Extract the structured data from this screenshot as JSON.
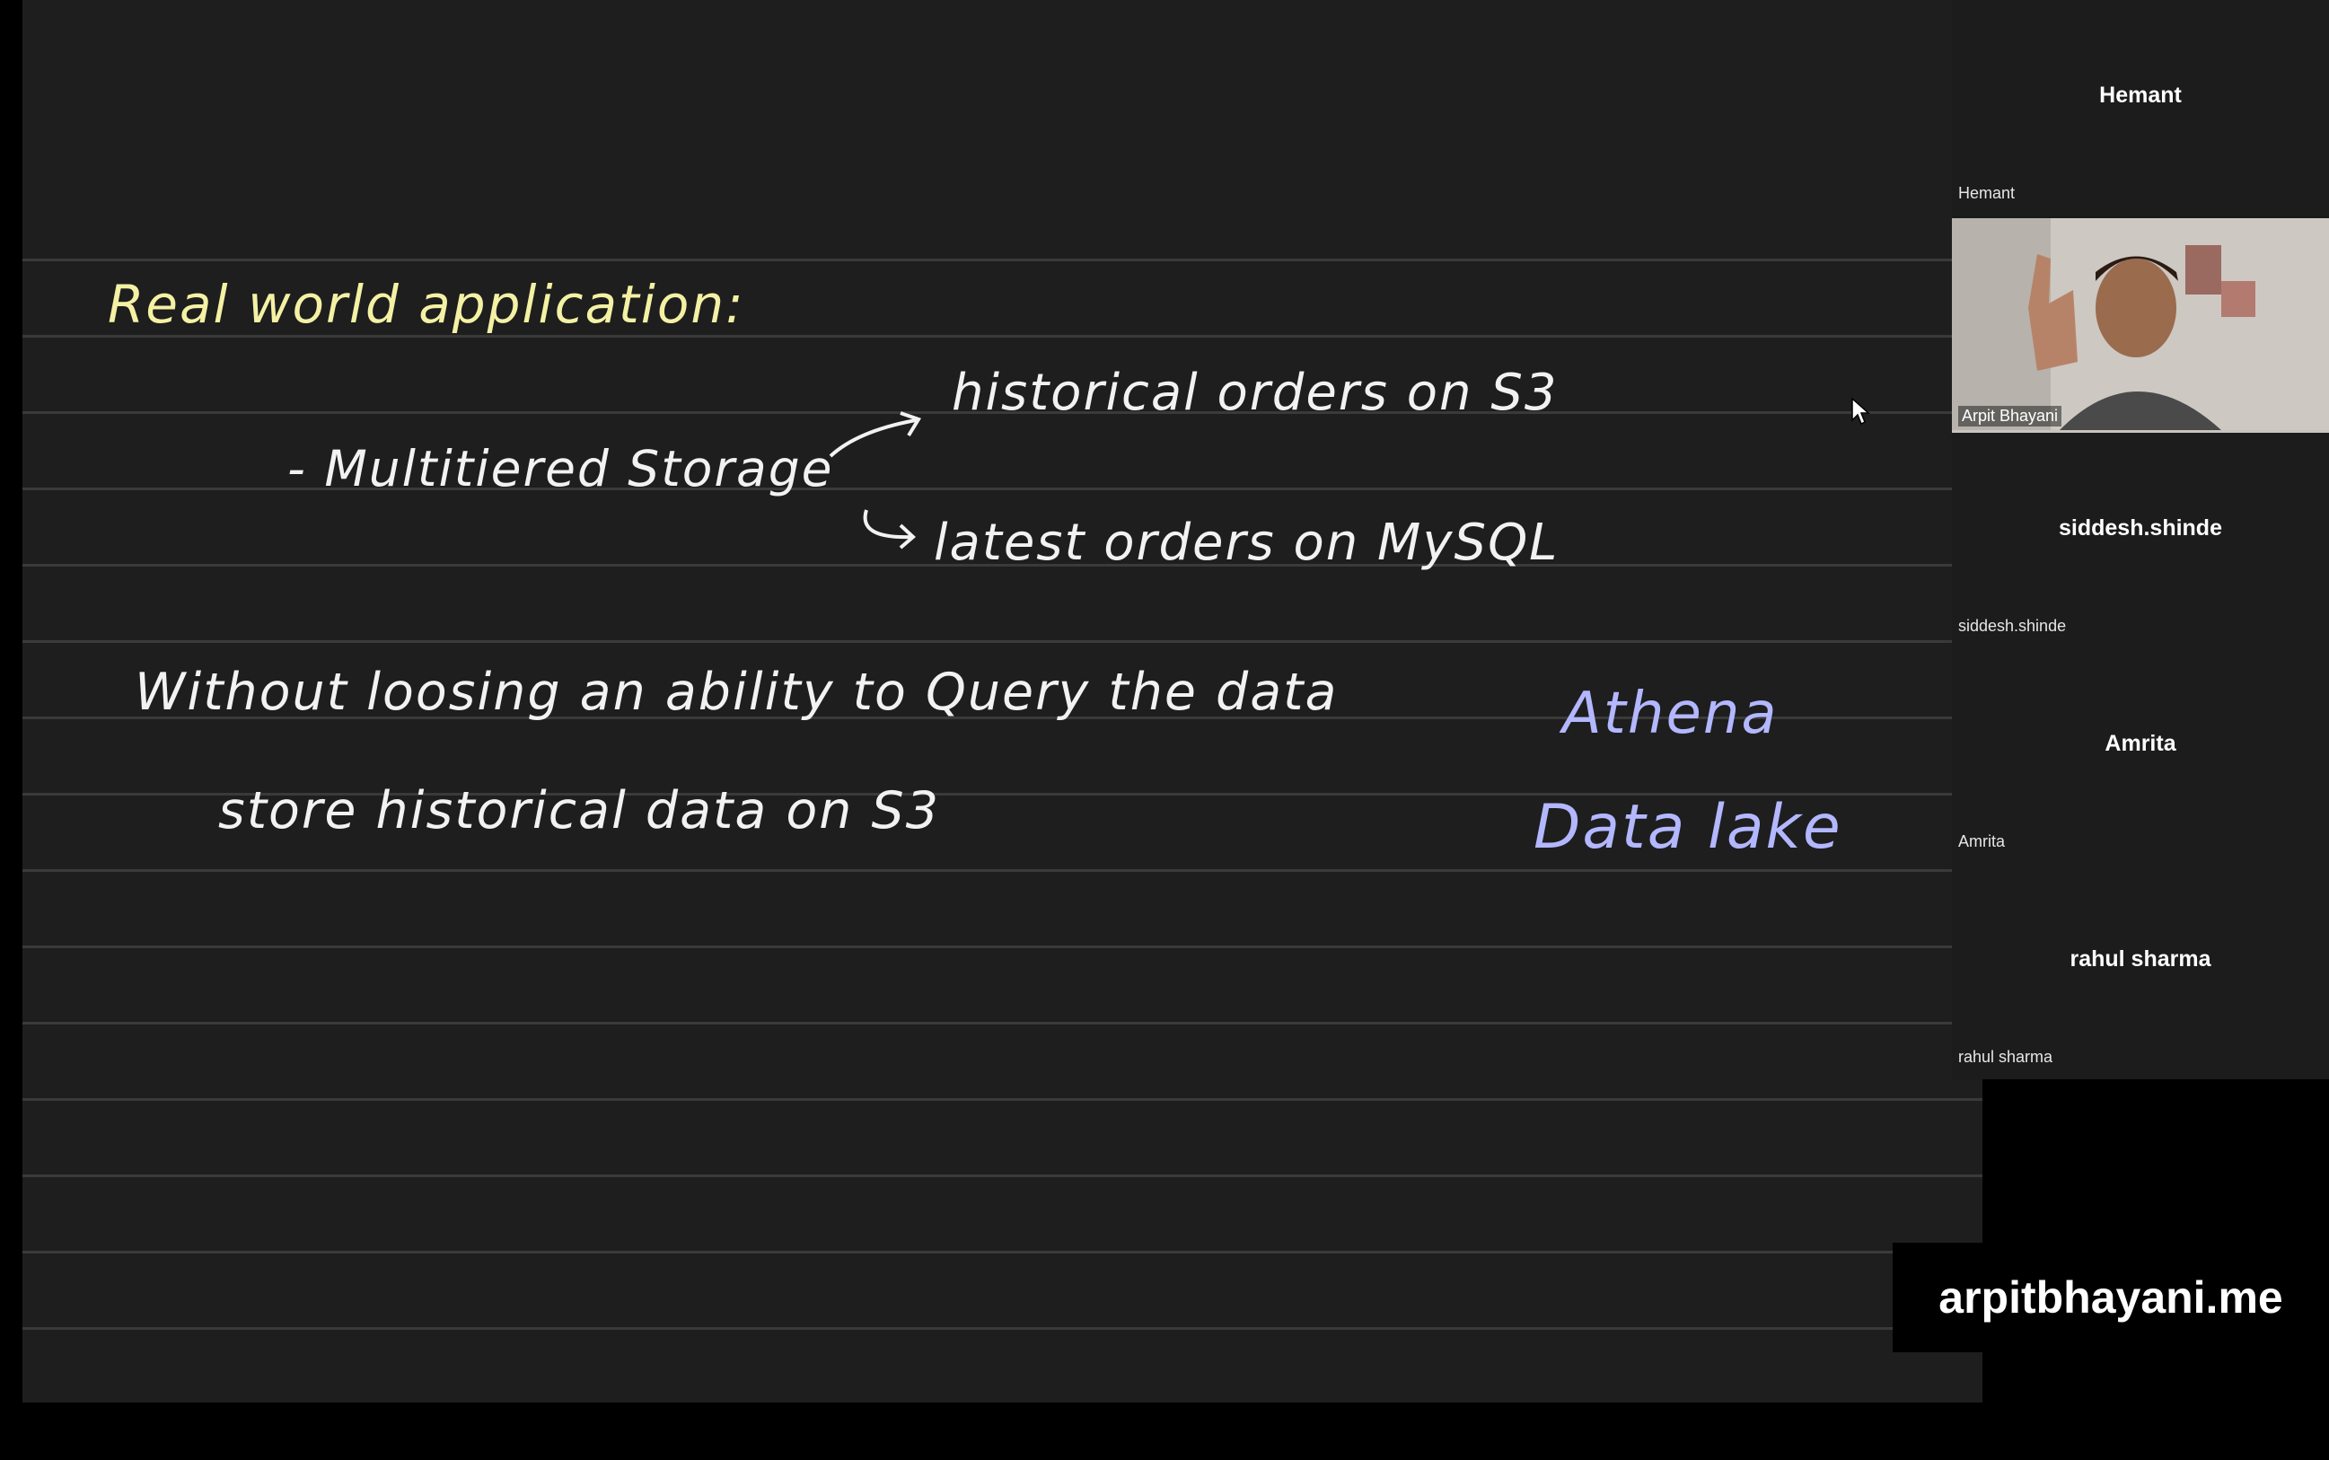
{
  "whiteboard": {
    "title": "Real world application:",
    "point": "- Multitiered Storage",
    "branch_top": "historical orders on S3",
    "branch_bottom": "latest orders on MySQL",
    "line1": "Without loosing an ability to Query the data",
    "line2": "store historical data on S3",
    "note1": "Athena",
    "note2": "Data lake"
  },
  "participants": [
    {
      "center": "Hemant",
      "corner": "Hemant"
    },
    {
      "video_label": "Arpit Bhayani"
    },
    {
      "center": "siddesh.shinde",
      "corner": "siddesh.shinde"
    },
    {
      "center": "Amrita",
      "corner": "Amrita"
    },
    {
      "center": "rahul sharma",
      "corner": "rahul sharma"
    }
  ],
  "watermark": "arpitbhayani.me",
  "colors": {
    "board": "#1e1e1e",
    "ink_yellow": "#f4f1a4",
    "ink_white": "#f2f2f2",
    "ink_purple": "#b3b7ff"
  },
  "icons": {
    "cursor": "arrow-cursor-icon"
  }
}
